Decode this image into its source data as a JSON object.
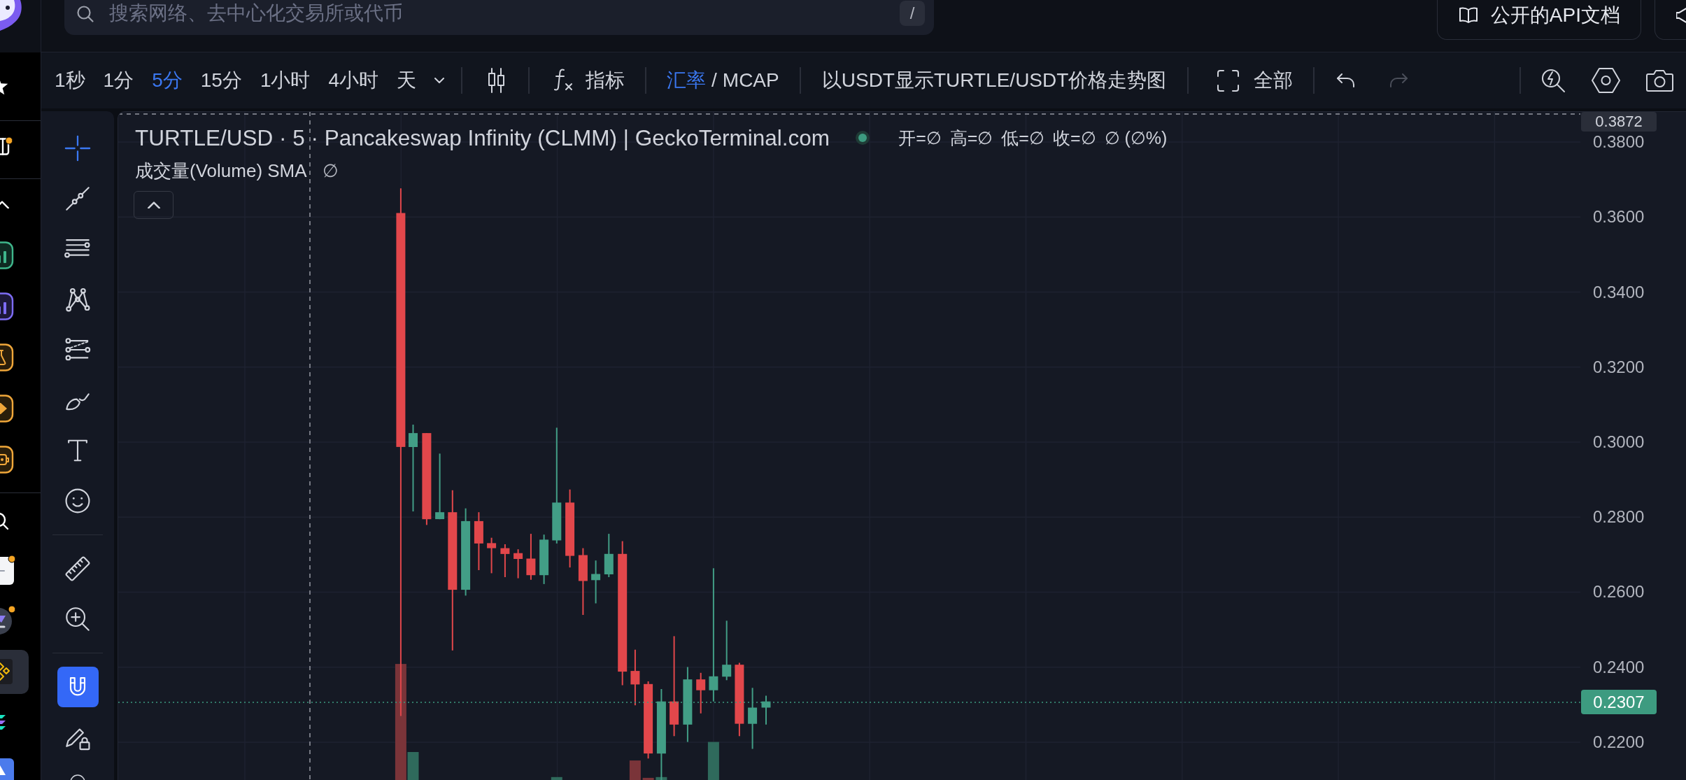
{
  "outer_sidebar": {
    "top_items": [
      {
        "kind": "star",
        "notified": false
      },
      {
        "kind": "portfolio",
        "notified": true
      }
    ],
    "section": {
      "expanded": true
    },
    "apps": [
      {
        "kind": "green_chart"
      },
      {
        "kind": "purple_chart"
      },
      {
        "kind": "flask"
      },
      {
        "kind": "tag"
      },
      {
        "kind": "robot"
      }
    ],
    "tokens": [
      {
        "kind": "white_logo",
        "selected": false,
        "notified": true
      },
      {
        "kind": "grey_logo",
        "selected": false,
        "notified": true
      },
      {
        "kind": "cube_logo",
        "selected": true,
        "notified": false
      },
      {
        "kind": "stripes_logo",
        "selected": false,
        "notified": false
      },
      {
        "kind": "blue_logo",
        "selected": false,
        "notified": false
      }
    ]
  },
  "search": {
    "placeholder": "搜索网络、去中心化交易所或代币",
    "shortcut": "/"
  },
  "header_buttons": [
    {
      "kind": "docs",
      "label": "公开的API文档"
    },
    {
      "kind": "feedback"
    }
  ],
  "toolbar": {
    "timeframes": [
      {
        "label": "1秒",
        "selected": false
      },
      {
        "label": "1分",
        "selected": false
      },
      {
        "label": "5分",
        "selected": true
      },
      {
        "label": "15分",
        "selected": false
      },
      {
        "label": "1小时",
        "selected": false
      },
      {
        "label": "4小时",
        "selected": false
      },
      {
        "label": "天",
        "selected": false
      }
    ],
    "indicators": {
      "label": "指标"
    },
    "price_modes": [
      {
        "label": "汇率",
        "selected": true
      },
      {
        "label": "MCAP",
        "selected": false
      }
    ],
    "price_mode_separator": "/",
    "quote_toggle": {
      "label": "以USDT显示TURTLE/USDT价格走势图"
    },
    "range": {
      "label": "全部"
    },
    "undo": {
      "disabled": false
    },
    "redo": {
      "disabled": true
    }
  },
  "drawing_tools": {
    "tools": [
      {
        "kind": "crosshair",
        "selected": true
      },
      {
        "kind": "trend_line",
        "selected": false
      },
      {
        "kind": "parallel_lines",
        "selected": false
      },
      {
        "kind": "pattern",
        "selected": false
      },
      {
        "kind": "projection",
        "selected": false
      },
      {
        "kind": "brush",
        "selected": false
      },
      {
        "kind": "text",
        "selected": false
      },
      {
        "kind": "emoji",
        "selected": false
      }
    ],
    "measures": [
      {
        "kind": "ruler"
      },
      {
        "kind": "zoom_in"
      }
    ],
    "toggles": [
      {
        "kind": "magnet",
        "on": true
      },
      {
        "kind": "lock",
        "on": false
      }
    ],
    "more": [
      {
        "kind": "cut_off"
      }
    ]
  },
  "chart": {
    "legend": {
      "title": "TURTLE/USD · 5 · Pancakeswap Infinity (CLMM) | GeckoTerminal.com",
      "values": [
        "开=∅",
        "高=∅",
        "低=∅",
        "收=∅",
        "∅ (∅%)"
      ],
      "expanded": true
    },
    "volume_legend": {
      "label": "成交量(Volume) SMA",
      "value": "∅"
    },
    "price_axis": {
      "labels": [
        "0.3800",
        "0.3600",
        "0.3400",
        "0.3200",
        "0.3000",
        "0.2800",
        "0.2600",
        "0.2400",
        "0.2200"
      ],
      "crosshair_label": "0.3872",
      "last_price_label": "0.2307"
    }
  }
}
